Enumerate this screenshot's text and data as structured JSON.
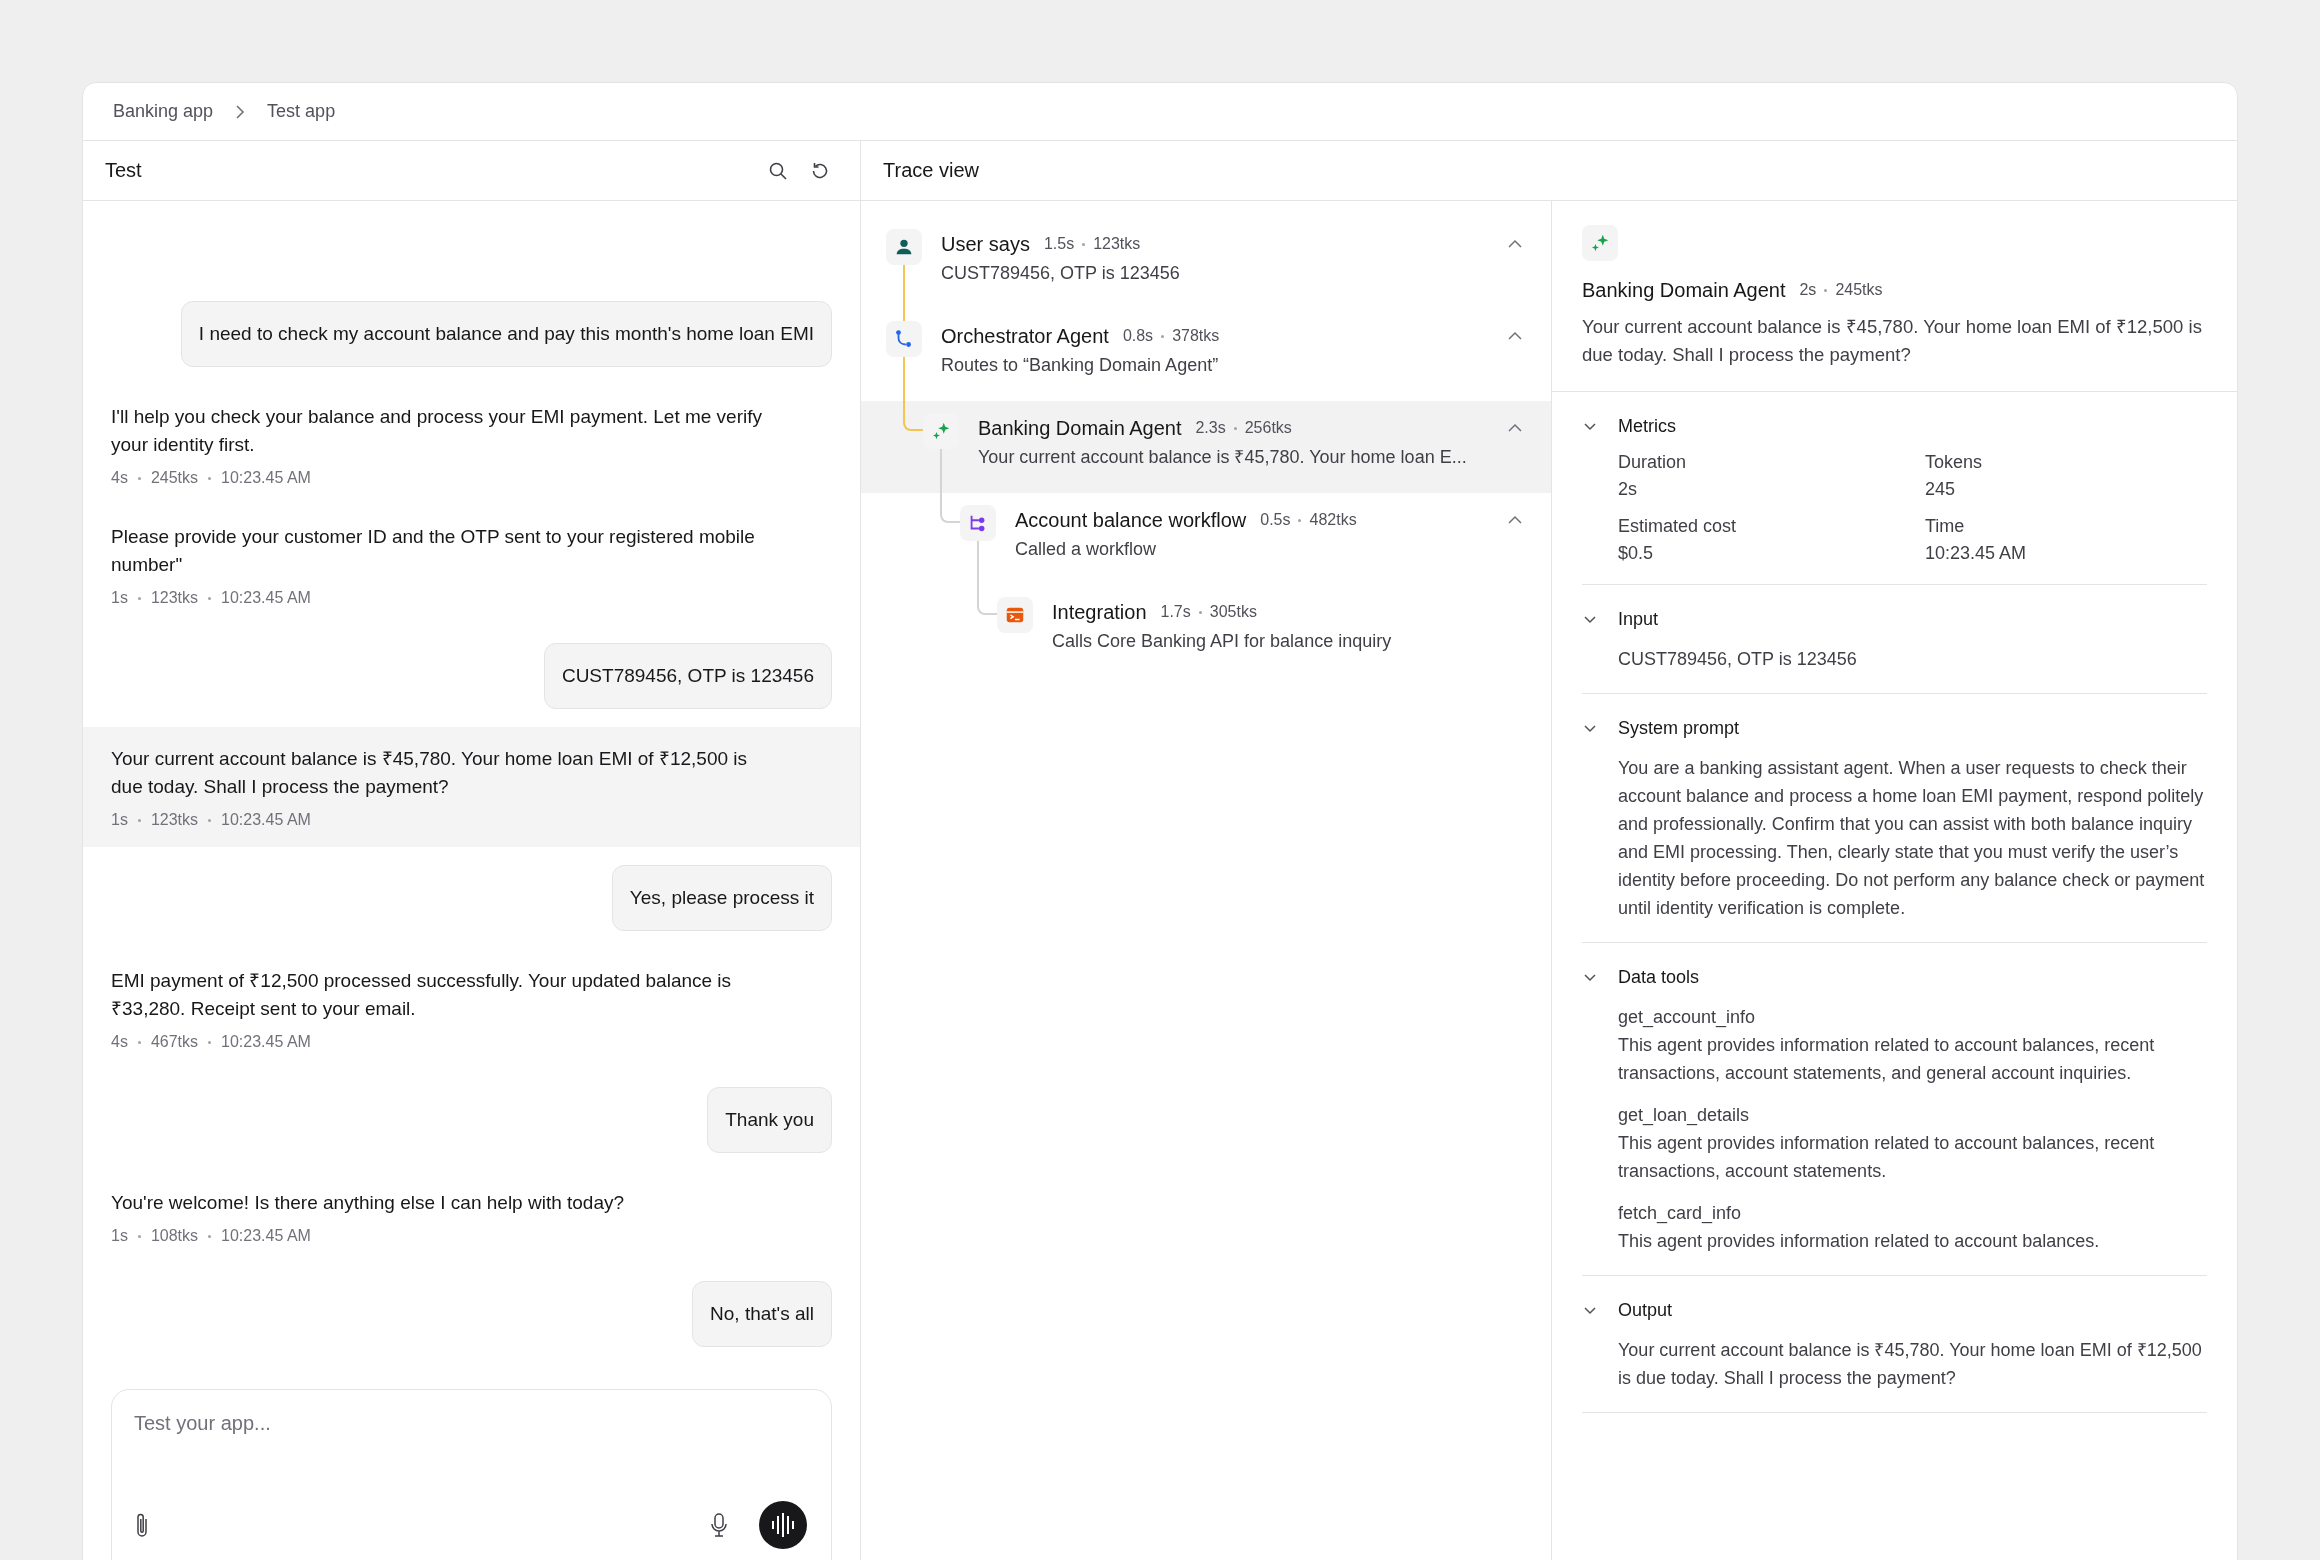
{
  "breadcrumb": [
    "Banking app",
    "Test app"
  ],
  "chat": {
    "title": "Test",
    "messages": [
      {
        "kind": "user",
        "text": "I need to check my account balance and pay this month's home loan EMI",
        "selected": false
      },
      {
        "kind": "assistant",
        "text": "I'll help you check your balance and process your EMI payment. Let me verify your identity first.",
        "meta": [
          "4s",
          "245tks",
          "10:23.45 AM"
        ],
        "selected": false
      },
      {
        "kind": "assistant",
        "text": "Please provide your customer ID and the OTP sent to your registered mobile number\"",
        "meta": [
          "1s",
          "123tks",
          "10:23.45 AM"
        ],
        "selected": false
      },
      {
        "kind": "user",
        "text": "CUST789456, OTP is 123456",
        "selected": false
      },
      {
        "kind": "assistant",
        "text": "Your current account balance is ₹45,780. Your home loan EMI of ₹12,500 is due today. Shall I process the payment?",
        "meta": [
          "1s",
          "123tks",
          "10:23.45 AM"
        ],
        "selected": true
      },
      {
        "kind": "user",
        "text": "Yes, please process it",
        "selected": false
      },
      {
        "kind": "assistant",
        "text": "EMI payment of ₹12,500 processed successfully. Your updated balance is ₹33,280. Receipt sent to your email.",
        "meta": [
          "4s",
          "467tks",
          "10:23.45 AM"
        ],
        "selected": false
      },
      {
        "kind": "user",
        "text": "Thank you",
        "selected": false
      },
      {
        "kind": "assistant",
        "text": "You're welcome! Is there anything else I can help with today?",
        "meta": [
          "1s",
          "108tks",
          "10:23.45 AM"
        ],
        "selected": false
      },
      {
        "kind": "user",
        "text": "No, that's all",
        "selected": false
      }
    ],
    "input": {
      "placeholder": "Test your app..."
    }
  },
  "trace": {
    "title": "Trace view",
    "items": [
      {
        "kind": "user",
        "title": "User says",
        "meta": [
          "1.5s",
          "123tks"
        ],
        "text": "CUST789456, OTP is 123456",
        "expanded": true,
        "selected": false
      },
      {
        "kind": "router",
        "title": "Orchestrator Agent",
        "meta": [
          "0.8s",
          "378tks"
        ],
        "text": "Routes to “Banking Domain Agent”",
        "expanded": true,
        "selected": false,
        "children": [
          {
            "kind": "agent",
            "title": "Banking Domain Agent",
            "meta": [
              "2.3s",
              "256tks"
            ],
            "text": "Your current account balance is ₹45,780. Your home loan E...",
            "expanded": true,
            "selected": true,
            "children": [
              {
                "kind": "workflow",
                "title": "Account balance workflow",
                "meta": [
                  "0.5s",
                  "482tks"
                ],
                "text": "Called a workflow",
                "expanded": true,
                "selected": false,
                "children": [
                  {
                    "kind": "integration",
                    "title": "Integration",
                    "meta": [
                      "1.7s",
                      "305tks"
                    ],
                    "text": "Calls Core Banking API for balance inquiry",
                    "selected": false
                  }
                ]
              }
            ]
          }
        ]
      }
    ]
  },
  "detail": {
    "kind": "agent",
    "title": "Banking Domain Agent",
    "meta": [
      "2s",
      "245tks"
    ],
    "text": "Your current account balance is ₹45,780. Your home loan EMI of ₹12,500 is due today. Shall I process the payment?",
    "sections": [
      {
        "kind": "metrics",
        "title": "Metrics",
        "expanded": true,
        "metrics": [
          {
            "label": "Duration",
            "value": "2s"
          },
          {
            "label": "Tokens",
            "value": "245"
          },
          {
            "label": "Estimated cost",
            "value": "$0.5"
          },
          {
            "label": "Time",
            "value": "10:23.45 AM"
          }
        ]
      },
      {
        "kind": "text",
        "title": "Input",
        "expanded": true,
        "text": "CUST789456, OTP is 123456"
      },
      {
        "kind": "text",
        "title": "System prompt",
        "expanded": true,
        "text": "You are a banking assistant agent. When a user requests to check their account balance and process a home loan EMI payment, respond politely and professionally. Confirm that you can assist with both balance inquiry and EMI processing. Then, clearly state that you must verify the user’s identity before proceeding. Do not perform any balance check or payment until identity verification is complete."
      },
      {
        "kind": "tools",
        "title": "Data tools",
        "expanded": true,
        "tools": [
          {
            "name": "get_account_info",
            "description": "This agent provides information related to account balances, recent transactions, account statements, and general account inquiries."
          },
          {
            "name": "get_loan_details",
            "description": "This agent provides information related to account balances, recent transactions, account statements."
          },
          {
            "name": "fetch_card_info",
            "description": "This agent provides information related to account balances."
          }
        ]
      },
      {
        "kind": "text",
        "title": "Output",
        "expanded": true,
        "text": "Your current account balance is ₹45,780. Your home loan EMI of ₹12,500 is due today. Shall I process the payment?"
      }
    ]
  }
}
